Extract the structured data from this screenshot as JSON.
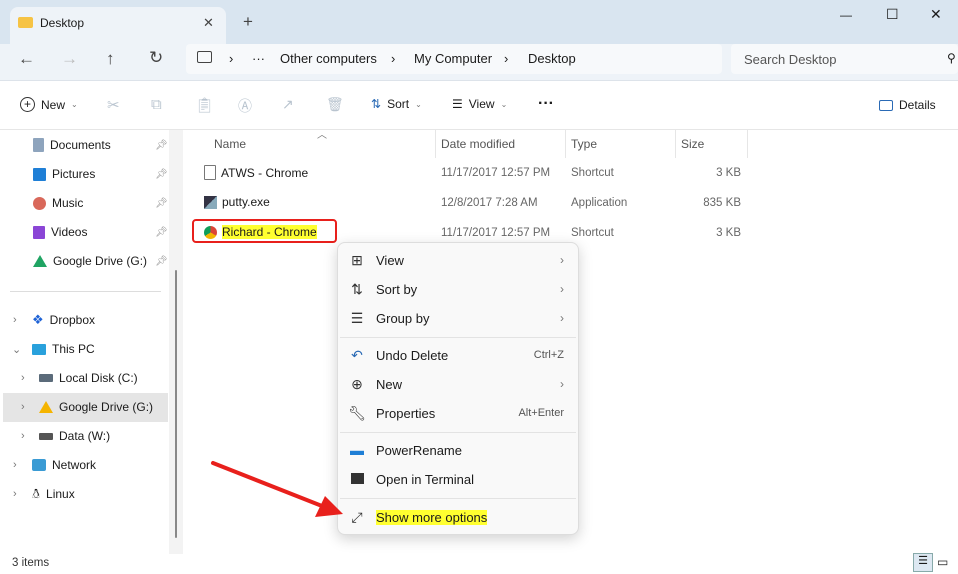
{
  "tab": {
    "title": "Desktop",
    "new_tab": "+"
  },
  "window": {
    "minimize": "—",
    "maximize": "☐",
    "close": "✕"
  },
  "nav": {
    "breadcrumb": [
      "Other computers",
      "My Computer",
      "Desktop"
    ],
    "overflow": "···",
    "search_placeholder": "Search Desktop"
  },
  "toolbar": {
    "new": "New",
    "sort": "Sort",
    "view": "View",
    "more": "···",
    "details": "Details"
  },
  "sidebar": {
    "pinned": [
      {
        "label": "Documents",
        "icon": "documents-icon"
      },
      {
        "label": "Pictures",
        "icon": "pictures-icon"
      },
      {
        "label": "Music",
        "icon": "music-icon"
      },
      {
        "label": "Videos",
        "icon": "videos-icon"
      },
      {
        "label": "Google Drive (G:)",
        "icon": "google-drive-icon"
      }
    ],
    "tree": [
      {
        "label": "Dropbox"
      },
      {
        "label": "This PC"
      },
      {
        "label": "Local Disk (C:)"
      },
      {
        "label": "Google Drive (G:)"
      },
      {
        "label": "Data (W:)"
      },
      {
        "label": "Network"
      },
      {
        "label": "Linux"
      }
    ]
  },
  "columns": [
    "Name",
    "Date modified",
    "Type",
    "Size"
  ],
  "files": [
    {
      "name": "ATWS - Chrome",
      "date": "11/17/2017 12:57 PM",
      "type": "Shortcut",
      "size": "3 KB"
    },
    {
      "name": "putty.exe",
      "date": "12/8/2017 7:28 AM",
      "type": "Application",
      "size": "835 KB"
    },
    {
      "name": "Richard - Chrome",
      "date": "11/17/2017 12:57 PM",
      "type": "Shortcut",
      "size": "3 KB"
    }
  ],
  "menu": {
    "items": [
      {
        "label": "View",
        "shortcut": "",
        "sub": true
      },
      {
        "label": "Sort by",
        "shortcut": "",
        "sub": true
      },
      {
        "label": "Group by",
        "shortcut": "",
        "sub": true
      },
      {
        "label": "Undo Delete",
        "shortcut": "Ctrl+Z",
        "sub": false
      },
      {
        "label": "New",
        "shortcut": "",
        "sub": true
      },
      {
        "label": "Properties",
        "shortcut": "Alt+Enter",
        "sub": false
      },
      {
        "label": "PowerRename",
        "shortcut": "",
        "sub": false
      },
      {
        "label": "Open in Terminal",
        "shortcut": "",
        "sub": false
      },
      {
        "label": "Show more options",
        "shortcut": "",
        "sub": false
      }
    ]
  },
  "status": {
    "items": "3 items"
  },
  "colors": {
    "highlight": "#ffff30",
    "annotation": "#e8201c"
  }
}
